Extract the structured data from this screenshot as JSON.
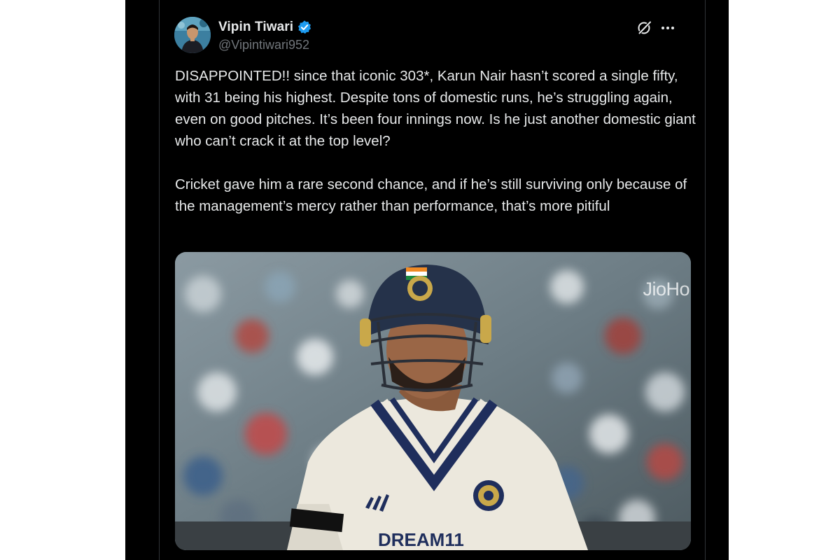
{
  "tweet": {
    "author": {
      "display_name": "Vipin Tiwari",
      "handle": "@Vipintiwari952",
      "verified": true
    },
    "icons": {
      "grok": "grok-icon",
      "more": "more-icon",
      "verified": "verified-badge-icon"
    },
    "paragraphs": [
      "DISAPPOINTED!! since that iconic 303*, Karun Nair hasn’t scored a single fifty, with 31 being his highest. Despite tons of domestic runs, he’s struggling again, even on good pitches. It’s been four innings now. Is he just another domestic giant who can’t crack it at the top level?",
      "Cricket gave him a rare second chance, and if he’s still surviving only because of the management’s mercy rather than performance, that’s more pitiful"
    ],
    "media": {
      "watermark": "JioHo",
      "jersey_text": "DREAM11"
    }
  },
  "colors": {
    "background": "#000000",
    "text_primary": "#e7e9ea",
    "text_secondary": "#71767b",
    "verified_blue": "#1d9bf0",
    "border": "#2f3336"
  }
}
